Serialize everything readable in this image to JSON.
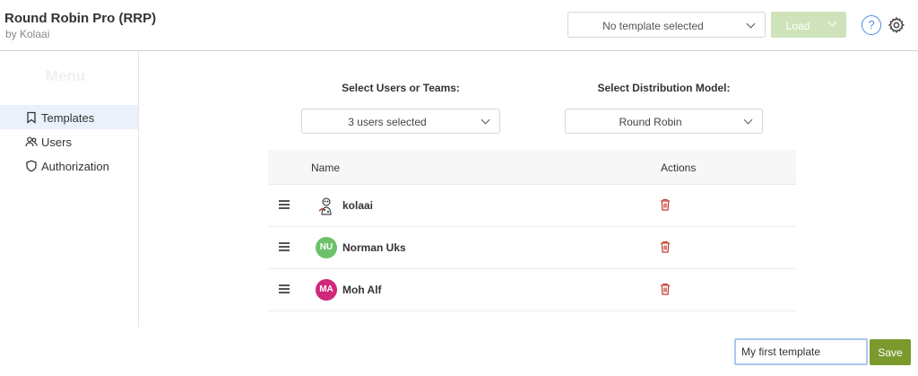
{
  "header": {
    "app_title": "Round Robin Pro (RRP)",
    "app_subtitle": "by Kolaai",
    "template_select": {
      "value": "No template selected"
    },
    "load_button": {
      "label": "Load",
      "color": "#cfe3bb"
    },
    "help_icon": "?"
  },
  "sidebar": {
    "title": "Menu",
    "items": [
      {
        "label": "Templates",
        "icon": "bookmark-icon",
        "active": true
      },
      {
        "label": "Users",
        "icon": "users-icon",
        "active": false
      },
      {
        "label": "Authorization",
        "icon": "shield-icon",
        "active": false
      }
    ]
  },
  "filters": {
    "users": {
      "label": "Select Users or Teams:",
      "value": "3 users selected"
    },
    "model": {
      "label": "Select Distribution Model:",
      "value": "Round Robin"
    }
  },
  "table": {
    "columns": [
      "Name",
      "Actions"
    ],
    "rows": [
      {
        "name": "kolaai",
        "avatar_type": "image"
      },
      {
        "name": "Norman Uks",
        "initials": "NU",
        "avatar_color": "#6cc26b"
      },
      {
        "name": "Moh Alf",
        "initials": "MA",
        "avatar_color": "#d0287a"
      }
    ]
  },
  "footer": {
    "template_name_value": "My first template",
    "save_label": "Save",
    "save_color": "#7a9a2e"
  }
}
